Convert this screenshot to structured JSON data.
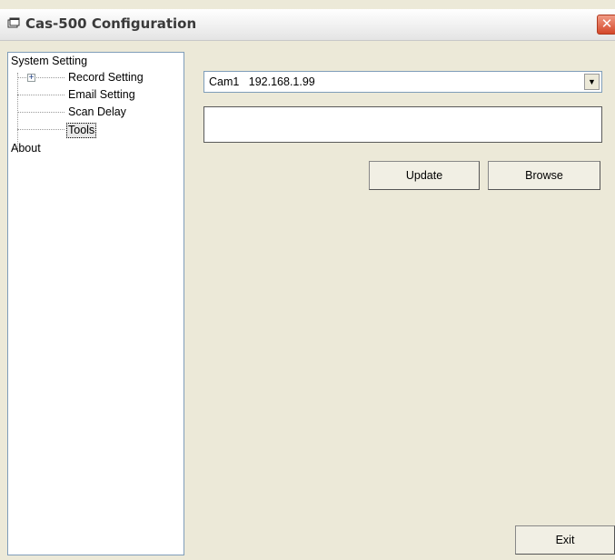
{
  "window": {
    "title": "Cas-500 Configuration",
    "close_label": "✕"
  },
  "tree": {
    "items": [
      {
        "label": "System Setting"
      },
      {
        "label": "Record Setting",
        "expander": "+"
      },
      {
        "label": "Email Setting"
      },
      {
        "label": "Scan Delay"
      },
      {
        "label": "Tools",
        "selected": true
      },
      {
        "label": "About"
      }
    ]
  },
  "camera_select": {
    "value": "Cam1   192.168.1.99",
    "arrow": "▼"
  },
  "buttons": {
    "update": "Update",
    "browse": "Browse",
    "exit": "Exit"
  }
}
